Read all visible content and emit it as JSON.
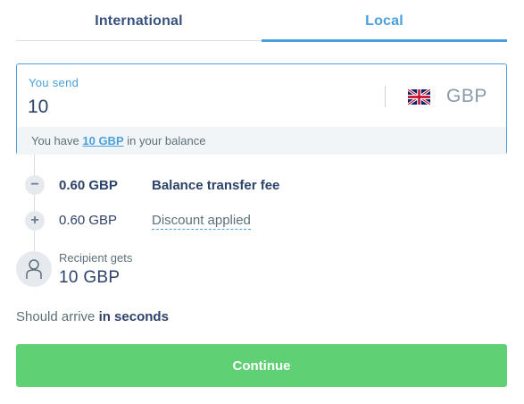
{
  "tabs": [
    {
      "label": "International",
      "active": false
    },
    {
      "label": "Local",
      "active": true
    }
  ],
  "send": {
    "label": "You send",
    "value": "10",
    "currency_code": "GBP",
    "flag_icon": "uk-flag-icon",
    "balance_prefix": "You have",
    "balance_amount": "10 GBP",
    "balance_suffix": "in your balance"
  },
  "breakdown": {
    "fee": {
      "icon": "minus-icon",
      "symbol": "−",
      "amount": "0.60 GBP",
      "label": "Balance transfer fee"
    },
    "discount": {
      "icon": "plus-icon",
      "symbol": "+",
      "amount": "0.60 GBP",
      "label": "Discount applied"
    }
  },
  "recipient": {
    "icon": "person-icon",
    "label": "Recipient gets",
    "value": "10 GBP"
  },
  "arrival": {
    "prefix": "Should arrive",
    "emphasis": "in seconds"
  },
  "actions": {
    "continue_label": "Continue"
  },
  "colors": {
    "accent": "#4a9fdc",
    "text_primary": "#2e4369",
    "button_green": "#5fd074"
  }
}
